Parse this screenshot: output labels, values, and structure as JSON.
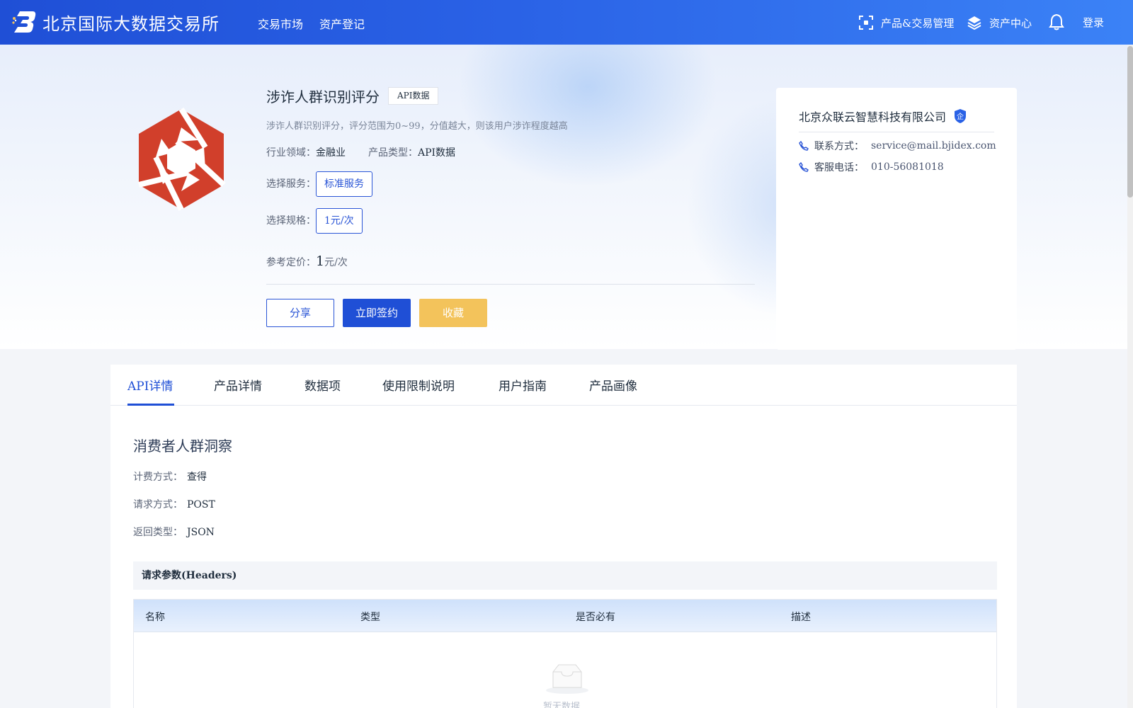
{
  "header": {
    "brand": "北京国际大数据交易所",
    "nav": [
      "交易市场",
      "资产登记"
    ],
    "right": {
      "manage": "产品&交易管理",
      "assets": "资产中心",
      "login": "登录"
    },
    "icons": [
      "scan-icon",
      "layers-icon",
      "bell-icon"
    ]
  },
  "product": {
    "title": "涉诈人群识别评分",
    "tag": "API数据",
    "description": "涉诈人群识别评分，评分范围为0~99，分值越大，则该用户涉诈程度越高",
    "industry_label": "行业领域：",
    "industry": "金融业",
    "type_label": "产品类型：",
    "type": "API数据",
    "service_label": "选择服务：",
    "service": "标准服务",
    "spec_label": "选择规格：",
    "spec": "1元/次",
    "price_label": "参考定价：",
    "price_value": "1",
    "price_unit": "元/次",
    "buttons": {
      "share": "分享",
      "sign": "立即签约",
      "favorite": "收藏"
    },
    "logo_color": "#d13f2b"
  },
  "company": {
    "name": "北京众联云智慧科技有限公司",
    "verified_badge": "企",
    "contact_label": "联系方式：",
    "contact": "service@mail.bjidex.com",
    "phone_label": "客服电话：",
    "phone": "010-56081018"
  },
  "tabs": [
    "API详情",
    "产品详情",
    "数据项",
    "使用限制说明",
    "用户指南",
    "产品画像"
  ],
  "active_tab": "API详情",
  "api": {
    "section_title": "消费者人群洞察",
    "billing_label": "计费方式：",
    "billing": "查得",
    "method_label": "请求方式：",
    "method": "POST",
    "return_label": "返回类型：",
    "return": "JSON",
    "headers_title": "请求参数(Headers)",
    "columns": [
      "名称",
      "类型",
      "是否必有",
      "描述"
    ],
    "empty_text": "暂无数据"
  },
  "colors": {
    "primary": "#1f4fd6",
    "favorite": "#f3c35b",
    "header_gradient_start": "#1f4fd6",
    "header_gradient_end": "#3b82f6"
  }
}
